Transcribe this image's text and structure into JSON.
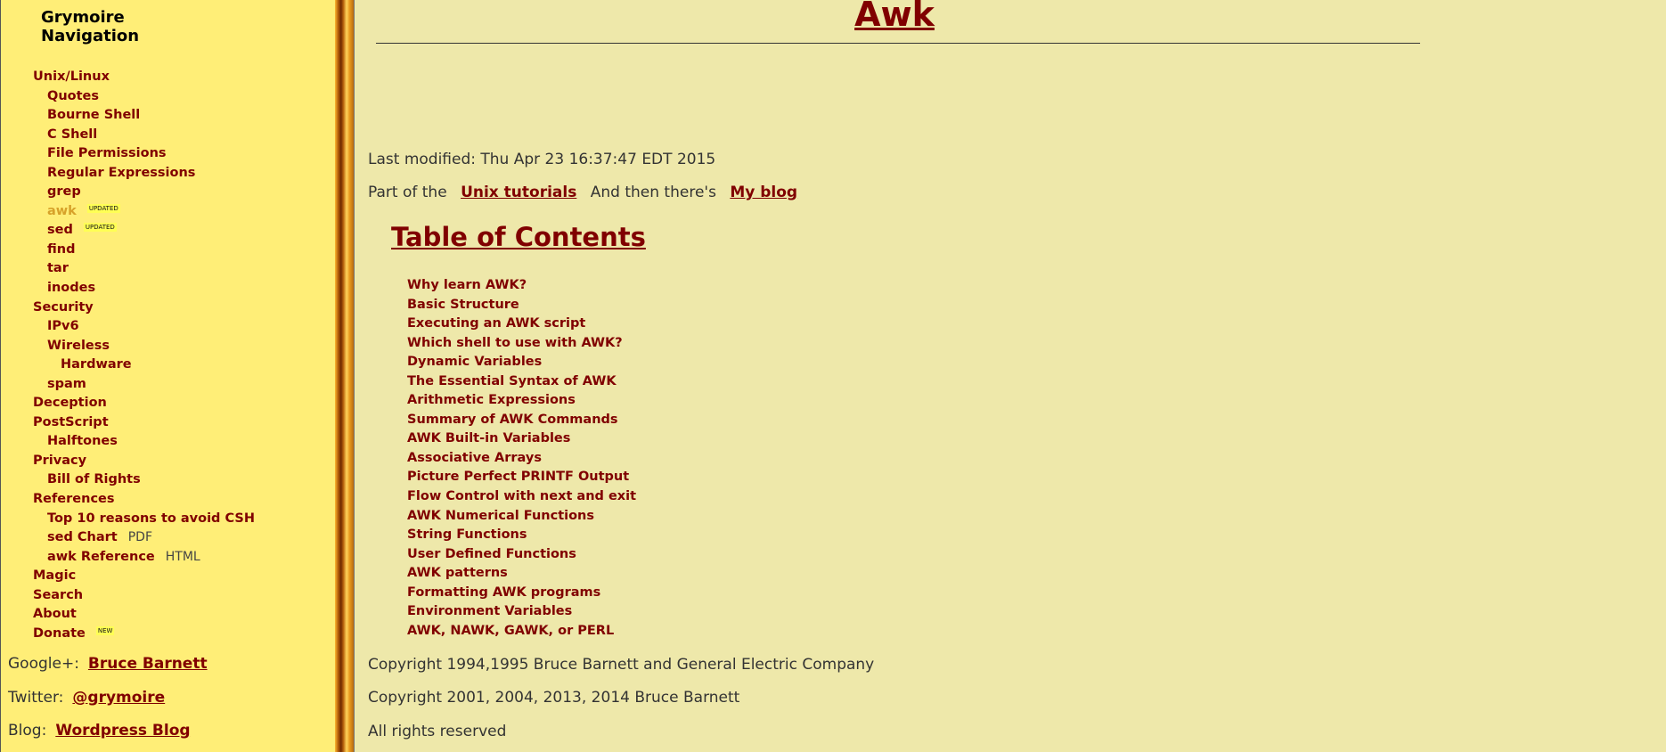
{
  "sidebar": {
    "heading": "Grymoire\nNavigation",
    "items": [
      {
        "label": "Unix/Linux",
        "level": 0
      },
      {
        "label": "Quotes",
        "level": 1
      },
      {
        "label": "Bourne Shell",
        "level": 1
      },
      {
        "label": "C Shell",
        "level": 1
      },
      {
        "label": "File Permissions",
        "level": 1
      },
      {
        "label": "Regular Expressions",
        "level": 1
      },
      {
        "label": "grep",
        "level": 1
      },
      {
        "label": "awk",
        "level": 1,
        "badge": "UPDATED",
        "current": true
      },
      {
        "label": "sed",
        "level": 1,
        "badge": "UPDATED"
      },
      {
        "label": "find",
        "level": 1
      },
      {
        "label": "tar",
        "level": 1
      },
      {
        "label": "inodes",
        "level": 1
      },
      {
        "label": "Security",
        "level": 0
      },
      {
        "label": "IPv6",
        "level": 1
      },
      {
        "label": "Wireless",
        "level": 1
      },
      {
        "label": "Hardware",
        "level": 2
      },
      {
        "label": "spam",
        "level": 1
      },
      {
        "label": "Deception",
        "level": 0
      },
      {
        "label": "PostScript",
        "level": 0
      },
      {
        "label": "Halftones",
        "level": 1
      },
      {
        "label": "Privacy",
        "level": 0
      },
      {
        "label": "Bill of Rights",
        "level": 1
      },
      {
        "label": "References",
        "level": 0
      },
      {
        "label": "Top 10 reasons to avoid CSH",
        "level": 1
      },
      {
        "label": "sed Chart",
        "level": 1,
        "suffix": "PDF"
      },
      {
        "label": "awk Reference",
        "level": 1,
        "suffix": "HTML"
      },
      {
        "label": "Magic",
        "level": 0
      },
      {
        "label": "Search",
        "level": 0
      },
      {
        "label": "About",
        "level": 0
      },
      {
        "label": "Donate",
        "level": 0,
        "badge": "NEW"
      }
    ],
    "social": [
      {
        "prefix": "Google+:",
        "link": "Bruce Barnett"
      },
      {
        "prefix": "Twitter:",
        "link": "@grymoire"
      },
      {
        "prefix": "Blog:",
        "link": "Wordpress Blog"
      }
    ]
  },
  "main": {
    "title": "Awk",
    "last_modified": "Last modified: Thu Apr 23 16:37:47 EDT 2015",
    "part_of": {
      "prefix": "Part of the",
      "tutorials_link": "Unix tutorials",
      "middle": "And then there's",
      "blog_link": "My blog"
    },
    "toc_title": "Table of Contents",
    "toc": [
      "Why learn AWK?",
      "Basic Structure",
      "Executing an AWK script",
      "Which shell to use with AWK?",
      "Dynamic Variables",
      "The Essential Syntax of AWK",
      "Arithmetic Expressions",
      "Summary of AWK Commands",
      "AWK Built-in Variables",
      "Associative Arrays",
      "Picture Perfect PRINTF Output",
      "Flow Control with next and exit",
      "AWK Numerical Functions",
      "String Functions",
      "User Defined Functions",
      "AWK patterns",
      "Formatting AWK programs",
      "Environment Variables",
      "AWK, NAWK, GAWK, or PERL"
    ],
    "copyright": [
      "Copyright 1994,1995 Bruce Barnett and General Electric Company",
      "Copyright 2001, 2004, 2013, 2014 Bruce Barnett",
      "All rights reserved"
    ]
  }
}
